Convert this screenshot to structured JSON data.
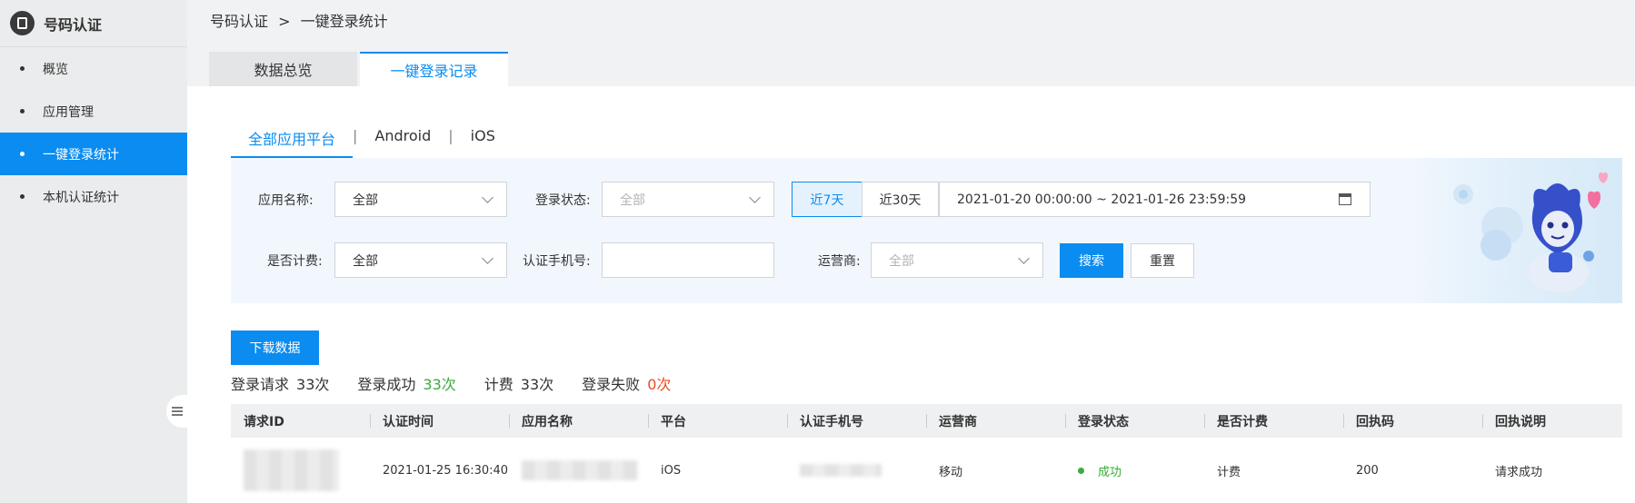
{
  "sidebar": {
    "title": "号码认证",
    "items": [
      {
        "label": "概览"
      },
      {
        "label": "应用管理"
      },
      {
        "label": "一键登录统计"
      },
      {
        "label": "本机认证统计"
      }
    ]
  },
  "breadcrumb": {
    "root": "号码认证",
    "separator": ">",
    "current": "一键登录统计"
  },
  "tabs": [
    {
      "label": "数据总览"
    },
    {
      "label": "一键登录记录"
    }
  ],
  "platform_tabs": [
    {
      "label": "全部应用平台"
    },
    {
      "label": "Android"
    },
    {
      "label": "iOS"
    }
  ],
  "platform_separator": "|",
  "filters": {
    "app_name": {
      "label": "应用名称:",
      "value": "全部"
    },
    "login_status": {
      "label": "登录状态:",
      "value": "全部"
    },
    "range_7": "近7天",
    "range_30": "近30天",
    "date_range": "2021-01-20 00:00:00 ~ 2021-01-26 23:59:59",
    "billing": {
      "label": "是否计费:",
      "value": "全部"
    },
    "phone": {
      "label": "认证手机号:",
      "value": ""
    },
    "carrier": {
      "label": "运营商:",
      "value": "全部"
    },
    "search_label": "搜索",
    "reset_label": "重置"
  },
  "download_label": "下载数据",
  "stats": [
    {
      "label": "登录请求",
      "value": "33次"
    },
    {
      "label": "登录成功",
      "value": "33次"
    },
    {
      "label": "计费",
      "value": "33次"
    },
    {
      "label": "登录失败",
      "value": "0次"
    }
  ],
  "table": {
    "columns": [
      "请求ID",
      "认证时间",
      "应用名称",
      "平台",
      "认证手机号",
      "运营商",
      "登录状态",
      "是否计费",
      "回执码",
      "回执说明"
    ],
    "rows": [
      {
        "request_id": "",
        "time": "2021-01-25 16:30:40",
        "app_name": "",
        "platform": "iOS",
        "phone": "",
        "carrier": "移动",
        "status": "成功",
        "billing": "计费",
        "code": "200",
        "message": "请求成功"
      }
    ]
  },
  "colors": {
    "accent": "#0a8cf0",
    "success": "#3aab3a",
    "danger": "#f04a1e"
  }
}
